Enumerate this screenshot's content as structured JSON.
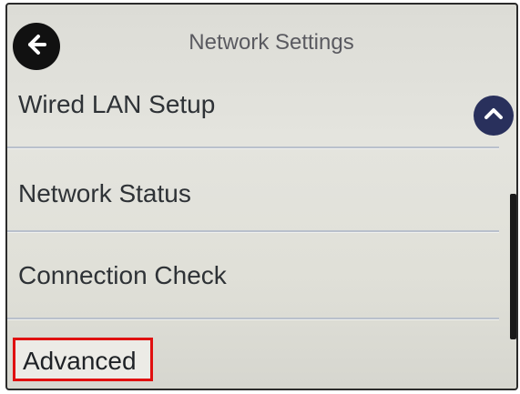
{
  "header": {
    "title": "Network Settings",
    "back_icon": "arrow-left-icon"
  },
  "menu": {
    "items": [
      {
        "label": "Wired LAN Setup"
      },
      {
        "label": "Network Status"
      },
      {
        "label": "Connection Check"
      },
      {
        "label": "Advanced",
        "highlighted": true
      }
    ]
  },
  "scroll": {
    "up_icon": "chevron-up-icon"
  },
  "colors": {
    "screen_background": "#e0e0d8",
    "divider": "#b9c0cc",
    "scroll_button": "#29305c",
    "highlight_border": "#e01010",
    "back_button": "#111111"
  }
}
